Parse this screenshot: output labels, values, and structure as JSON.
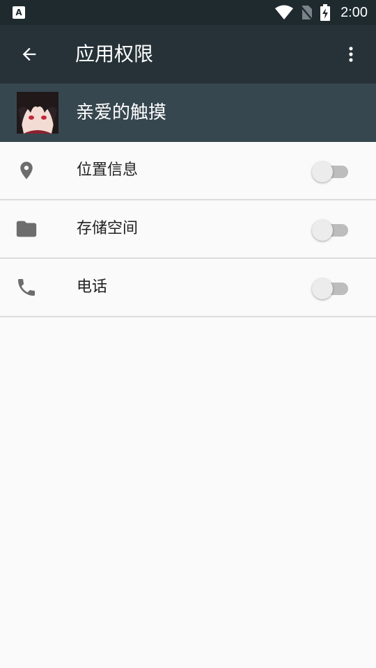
{
  "status_bar": {
    "left_icon_glyph": "A",
    "time": "2:00",
    "icons": [
      "wifi-icon",
      "no-sim-icon",
      "battery-charging-icon"
    ]
  },
  "toolbar": {
    "title": "应用权限",
    "back_icon": "arrow-left-icon",
    "overflow_icon": "more-vert-icon"
  },
  "app": {
    "name": "亲爱的触摸"
  },
  "permissions": [
    {
      "label": "位置信息",
      "icon": "location-pin-icon",
      "enabled": false
    },
    {
      "label": "存储空间",
      "icon": "folder-icon",
      "enabled": false
    },
    {
      "label": "电话",
      "icon": "phone-icon",
      "enabled": false
    }
  ],
  "colors": {
    "status_bar": "#1f2a2f",
    "toolbar": "#263238",
    "app_header": "#37474f",
    "background": "#fafafa",
    "icon_gray": "#6d6d6d"
  }
}
